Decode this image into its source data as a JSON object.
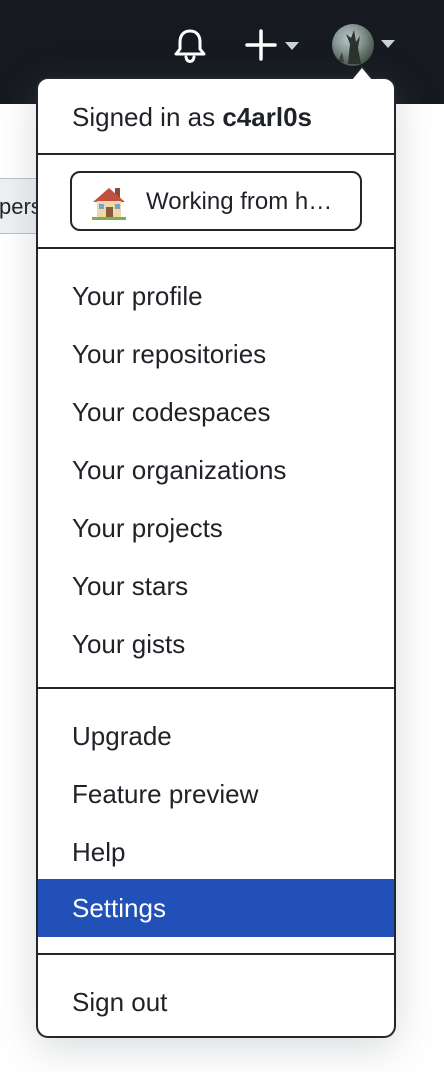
{
  "background": {
    "partial_button_text": "pers"
  },
  "header": {
    "icons": [
      "bell-icon",
      "plus-icon",
      "caret-down-icon",
      "avatar"
    ]
  },
  "menu": {
    "signed_in_prefix": "Signed in as",
    "username": "c4arl0s",
    "status": {
      "emoji": "house-icon",
      "text": "Working from h…"
    },
    "group1": [
      "Your profile",
      "Your repositories",
      "Your codespaces",
      "Your organizations",
      "Your projects",
      "Your stars",
      "Your gists"
    ],
    "group2": [
      "Upgrade",
      "Feature preview",
      "Help",
      "Settings"
    ],
    "active_item": "Settings",
    "signout": "Sign out"
  },
  "colors": {
    "header_bg": "#161a20",
    "active_bg": "#2150b8",
    "border": "#22262b"
  }
}
